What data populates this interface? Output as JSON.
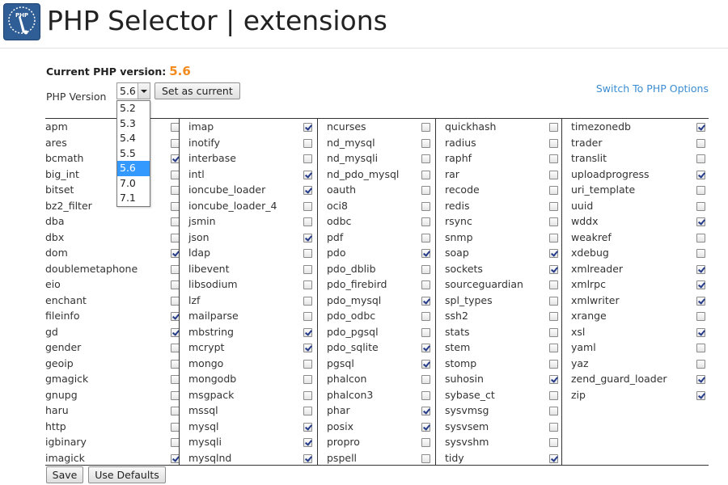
{
  "header": {
    "title": "PHP Selector | extensions",
    "icon": "php-selector-app-icon",
    "icon_text": "PHP"
  },
  "current_version": {
    "label": "Current PHP version:",
    "value": "5.6",
    "value_color": "#f28a1e"
  },
  "version_picker": {
    "label": "PHP Version",
    "selected": "5.6",
    "options": [
      "5.2",
      "5.3",
      "5.4",
      "5.5",
      "5.6",
      "7.0",
      "7.1"
    ],
    "highlight_color": "#3399ff"
  },
  "buttons": {
    "set_current": "Set as current",
    "save": "Save",
    "use_defaults": "Use Defaults"
  },
  "switch_link": "Switch To PHP Options",
  "extension_columns": [
    [
      {
        "name": "apm",
        "checked": false
      },
      {
        "name": "ares",
        "checked": false
      },
      {
        "name": "bcmath",
        "checked": true
      },
      {
        "name": "big_int",
        "checked": false
      },
      {
        "name": "bitset",
        "checked": false
      },
      {
        "name": "bz2_filter",
        "checked": false
      },
      {
        "name": "dba",
        "checked": false
      },
      {
        "name": "dbx",
        "checked": false
      },
      {
        "name": "dom",
        "checked": true
      },
      {
        "name": "doublemetaphone",
        "checked": false
      },
      {
        "name": "eio",
        "checked": false
      },
      {
        "name": "enchant",
        "checked": false
      },
      {
        "name": "fileinfo",
        "checked": true
      },
      {
        "name": "gd",
        "checked": true
      },
      {
        "name": "gender",
        "checked": false
      },
      {
        "name": "geoip",
        "checked": false
      },
      {
        "name": "gmagick",
        "checked": false
      },
      {
        "name": "gnupg",
        "checked": false
      },
      {
        "name": "haru",
        "checked": false
      },
      {
        "name": "http",
        "checked": false
      },
      {
        "name": "igbinary",
        "checked": false
      },
      {
        "name": "imagick",
        "checked": true
      }
    ],
    [
      {
        "name": "imap",
        "checked": true
      },
      {
        "name": "inotify",
        "checked": false
      },
      {
        "name": "interbase",
        "checked": false
      },
      {
        "name": "intl",
        "checked": true
      },
      {
        "name": "ioncube_loader",
        "checked": true
      },
      {
        "name": "ioncube_loader_4",
        "checked": false
      },
      {
        "name": "jsmin",
        "checked": false
      },
      {
        "name": "json",
        "checked": true
      },
      {
        "name": "ldap",
        "checked": false
      },
      {
        "name": "libevent",
        "checked": false
      },
      {
        "name": "libsodium",
        "checked": false
      },
      {
        "name": "lzf",
        "checked": false
      },
      {
        "name": "mailparse",
        "checked": false
      },
      {
        "name": "mbstring",
        "checked": true
      },
      {
        "name": "mcrypt",
        "checked": true
      },
      {
        "name": "mongo",
        "checked": false
      },
      {
        "name": "mongodb",
        "checked": false
      },
      {
        "name": "msgpack",
        "checked": false
      },
      {
        "name": "mssql",
        "checked": false
      },
      {
        "name": "mysql",
        "checked": true
      },
      {
        "name": "mysqli",
        "checked": true
      },
      {
        "name": "mysqlnd",
        "checked": true
      }
    ],
    [
      {
        "name": "ncurses",
        "checked": false
      },
      {
        "name": "nd_mysql",
        "checked": false
      },
      {
        "name": "nd_mysqli",
        "checked": false
      },
      {
        "name": "nd_pdo_mysql",
        "checked": false
      },
      {
        "name": "oauth",
        "checked": false
      },
      {
        "name": "oci8",
        "checked": false
      },
      {
        "name": "odbc",
        "checked": false
      },
      {
        "name": "pdf",
        "checked": false
      },
      {
        "name": "pdo",
        "checked": true
      },
      {
        "name": "pdo_dblib",
        "checked": false
      },
      {
        "name": "pdo_firebird",
        "checked": false
      },
      {
        "name": "pdo_mysql",
        "checked": true
      },
      {
        "name": "pdo_odbc",
        "checked": false
      },
      {
        "name": "pdo_pgsql",
        "checked": false
      },
      {
        "name": "pdo_sqlite",
        "checked": true
      },
      {
        "name": "pgsql",
        "checked": true
      },
      {
        "name": "phalcon",
        "checked": false
      },
      {
        "name": "phalcon3",
        "checked": false
      },
      {
        "name": "phar",
        "checked": true
      },
      {
        "name": "posix",
        "checked": true
      },
      {
        "name": "propro",
        "checked": false
      },
      {
        "name": "pspell",
        "checked": false
      }
    ],
    [
      {
        "name": "quickhash",
        "checked": false
      },
      {
        "name": "radius",
        "checked": false
      },
      {
        "name": "raphf",
        "checked": false
      },
      {
        "name": "rar",
        "checked": false
      },
      {
        "name": "recode",
        "checked": false
      },
      {
        "name": "redis",
        "checked": false
      },
      {
        "name": "rsync",
        "checked": false
      },
      {
        "name": "snmp",
        "checked": false
      },
      {
        "name": "soap",
        "checked": true
      },
      {
        "name": "sockets",
        "checked": true
      },
      {
        "name": "sourceguardian",
        "checked": false
      },
      {
        "name": "spl_types",
        "checked": false
      },
      {
        "name": "ssh2",
        "checked": false
      },
      {
        "name": "stats",
        "checked": false
      },
      {
        "name": "stem",
        "checked": false
      },
      {
        "name": "stomp",
        "checked": false
      },
      {
        "name": "suhosin",
        "checked": true
      },
      {
        "name": "sybase_ct",
        "checked": false
      },
      {
        "name": "sysvmsg",
        "checked": false
      },
      {
        "name": "sysvsem",
        "checked": false
      },
      {
        "name": "sysvshm",
        "checked": false
      },
      {
        "name": "tidy",
        "checked": true
      }
    ],
    [
      {
        "name": "timezonedb",
        "checked": true
      },
      {
        "name": "trader",
        "checked": false
      },
      {
        "name": "translit",
        "checked": false
      },
      {
        "name": "uploadprogress",
        "checked": true
      },
      {
        "name": "uri_template",
        "checked": false
      },
      {
        "name": "uuid",
        "checked": false
      },
      {
        "name": "wddx",
        "checked": true
      },
      {
        "name": "weakref",
        "checked": false
      },
      {
        "name": "xdebug",
        "checked": false
      },
      {
        "name": "xmlreader",
        "checked": true
      },
      {
        "name": "xmlrpc",
        "checked": true
      },
      {
        "name": "xmlwriter",
        "checked": true
      },
      {
        "name": "xrange",
        "checked": false
      },
      {
        "name": "xsl",
        "checked": true
      },
      {
        "name": "yaml",
        "checked": false
      },
      {
        "name": "yaz",
        "checked": false
      },
      {
        "name": "zend_guard_loader",
        "checked": true
      },
      {
        "name": "zip",
        "checked": true
      }
    ]
  ]
}
